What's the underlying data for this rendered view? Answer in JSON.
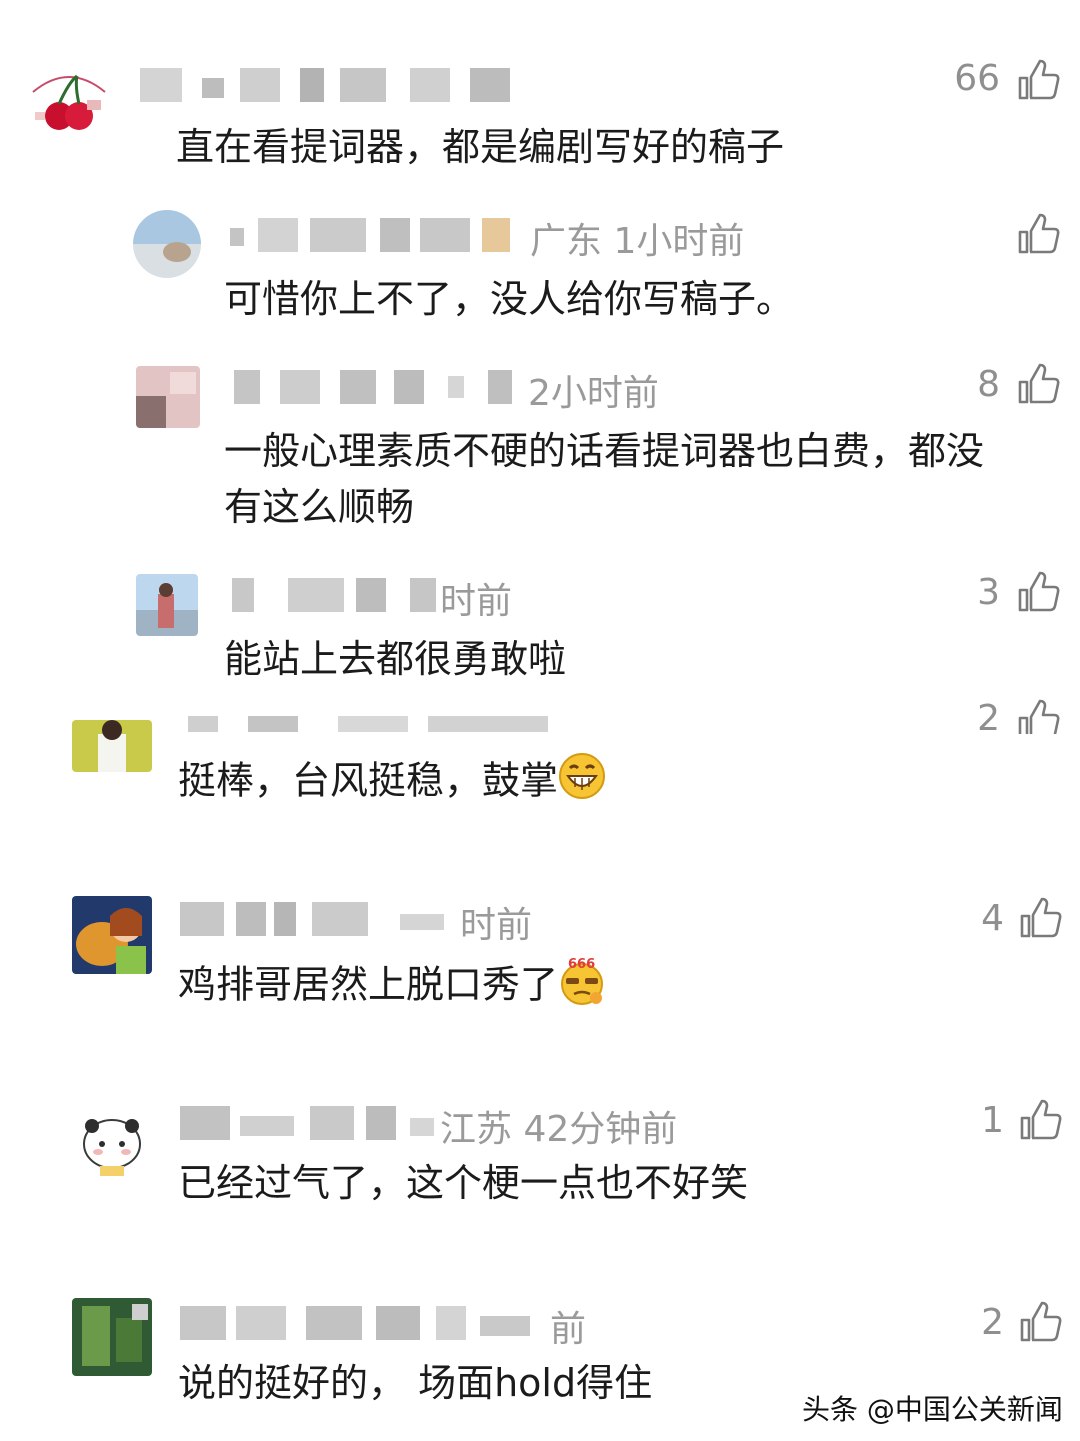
{
  "comments": [
    {
      "text": "直在看提词器，都是编剧写好的稿子",
      "likes": "66"
    },
    {
      "meta": "广东  1小时前",
      "text": "可惜你上不了，没人给你写稿子。",
      "likes": ""
    },
    {
      "meta": "2小时前",
      "text_line1": "一般心理素质不硬的话看提词器也白费，都没",
      "text_line2": "有这么顺畅",
      "likes": "8"
    },
    {
      "meta": "时前",
      "text": "能站上去都很勇敢啦",
      "likes": "3"
    },
    {
      "text": "挺棒，台风挺稳，鼓掌",
      "likes": "2",
      "emoji": "grinning-emoji"
    },
    {
      "meta": "时前",
      "text": "鸡排哥居然上脱口秀了",
      "likes": "4",
      "emoji": "666-emoji"
    },
    {
      "meta": "江苏  42分钟前",
      "text": "已经过气了，这个梗一点也不好笑",
      "likes": "1"
    },
    {
      "meta": "前",
      "text": "说的挺好的， 场面hold得住",
      "likes": "2"
    }
  ],
  "watermark": "头条 @中国公关新闻",
  "icons": {
    "like": "thumbs-up-icon"
  },
  "colors": {
    "text": "#1b1b1b",
    "meta": "#9a9a9a",
    "background": "#ffffff"
  }
}
